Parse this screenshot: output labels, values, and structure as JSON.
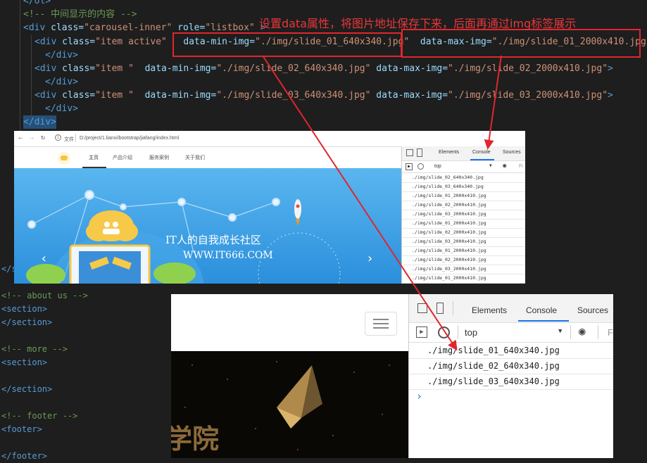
{
  "code_top": {
    "line_partial": "</ol>",
    "comment_middle": "<!-- 中间显示的内容 -->",
    "inner_open_tag": "<div",
    "inner_class_attr": "class=",
    "inner_class_val": "\"carousel-inner\"",
    "inner_role_attr": "role=",
    "inner_role_val": "\"listbox\"",
    "inner_gt": ">",
    "items": [
      {
        "open": "<div",
        "class_attr": "class=",
        "class_val": "\"item active\"",
        "min_attr": "data-min-img=",
        "min_val": "\"./img/slide_01_640x340.jpg\"",
        "max_attr": "data-max-img=",
        "max_val": "\"./img/slide_01_2000x410.jpg\"",
        "gt": ">"
      },
      {
        "open": "<div",
        "class_attr": "class=",
        "class_val": "\"item \"",
        "min_attr": "data-min-img=",
        "min_val": "\"./img/slide_02_640x340.jpg\"",
        "max_attr": "data-max-img=",
        "max_val": "\"./img/slide_02_2000x410.jpg\"",
        "gt": ">"
      },
      {
        "open": "<div",
        "class_attr": "class=",
        "class_val": "\"item \"",
        "min_attr": "data-min-img=",
        "min_val": "\"./img/slide_03_640x340.jpg\"",
        "max_attr": "data-max-img=",
        "max_val": "\"./img/slide_03_2000x410.jpg\"",
        "gt": ">"
      }
    ],
    "close_div": "</div>",
    "close_div_outer": "</div>"
  },
  "annotation": "设置data属性，将图片地址保存下来，后面再通过img标签展示",
  "code_bottom": {
    "lines": [
      {
        "text": "</s",
        "cls": "tag"
      },
      {
        "text": "<!-- about us -->",
        "cls": "cmt"
      },
      {
        "text": "<section>",
        "cls": "tag"
      },
      {
        "text": "</section>",
        "cls": "tag"
      },
      {
        "text": "",
        "cls": "txt"
      },
      {
        "text": "<!-- more -->",
        "cls": "cmt"
      },
      {
        "text": "<section>",
        "cls": "tag"
      },
      {
        "text": "",
        "cls": "txt"
      },
      {
        "text": "</section>",
        "cls": "tag"
      },
      {
        "text": "",
        "cls": "txt"
      },
      {
        "text": "<!-- footer -->",
        "cls": "cmt"
      },
      {
        "text": "<footer>",
        "cls": "tag"
      },
      {
        "text": "",
        "cls": "txt"
      },
      {
        "text": "</footer>",
        "cls": "tag"
      }
    ]
  },
  "browser1": {
    "file_label": "文件",
    "url": "D:/project/1.lianxi/bootstrap/jiafang/index.html",
    "nav_items": [
      "主页",
      "产品介绍",
      "服务案例",
      "关于我们"
    ],
    "hero_line1": "IT人的自我成长社区",
    "hero_line2": "WWW.IT666.COM",
    "devtools_tabs": [
      "Elements",
      "Console",
      "Sources"
    ],
    "context": "top",
    "filter_placeholder": "Fi",
    "console_rows": [
      "./img/slide_02_640x340.jpg",
      "./img/slide_03_640x340.jpg",
      "./img/slide_01_2000x410.jpg",
      "./img/slide_02_2000x410.jpg",
      "./img/slide_03_2000x410.jpg",
      "./img/slide_01_2000x410.jpg",
      "./img/slide_02_2000x410.jpg",
      "./img/slide_03_2000x410.jpg",
      "./img/slide_01_2000x410.jpg",
      "./img/slide_02_2000x410.jpg",
      "./img/slide_03_2000x410.jpg",
      "./img/slide_01_2000x410.jpg"
    ]
  },
  "browser2": {
    "devtools_tabs": [
      "Elements",
      "Console",
      "Sources"
    ],
    "context": "top",
    "filter_placeholder": "Fi",
    "console_rows": [
      "./img/slide_01_640x340.jpg",
      "./img/slide_02_640x340.jpg",
      "./img/slide_03_640x340.jpg"
    ],
    "prompt": "›",
    "hero_chars": "学院"
  },
  "colors": {
    "highlight_red": "#e0262d",
    "editor_bg": "#1e1e1e",
    "console_active": "#1a73e8"
  }
}
